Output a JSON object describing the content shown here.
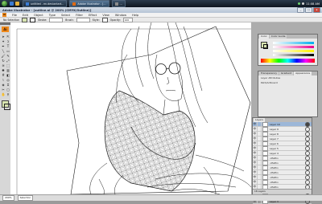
{
  "taskbar": {
    "tasks": [
      {
        "label": "untitled - en.deviantart..."
      },
      {
        "label": "Adobe Illustrator - [..."
      },
      {
        "label": "..."
      }
    ],
    "clock": "11:08 AM"
  },
  "window": {
    "title": "Adobe Illustrator - [outline.ai @ 200% (CMYK/Outline)]",
    "buttons": [
      "_",
      "□",
      "x"
    ]
  },
  "menubar": {
    "logo": "Ai",
    "items": [
      "File",
      "Edit",
      "Object",
      "Type",
      "Select",
      "Filter",
      "Effect",
      "View",
      "Window",
      "Help"
    ]
  },
  "controlbar": {
    "selection_label": "No Selection",
    "stroke_label": "Stroke:",
    "brush_label": "Brush:",
    "style_label": "Style:",
    "opacity_label": "Opacity:",
    "opacity_value": "100"
  },
  "colors": {
    "accent": "#f08a1c",
    "fill_swatch": "#d8e4b0",
    "layer_selected": "#9cb7d8"
  },
  "color_panel": {
    "tabs": [
      "Color",
      "Color Guide"
    ]
  },
  "appearance_panel": {
    "tabs": [
      "Transparency",
      "Gradient",
      "Appearance"
    ],
    "rows": [
      "Layer Attributes",
      "Path/Artboard"
    ]
  },
  "layers_panel": {
    "tabs": [
      "Layers"
    ],
    "rows": [
      "Layer 10",
      "Layer 9",
      "Layer 8",
      "Layer 7",
      "Layer 6",
      "Layer 5",
      "Layer 4",
      "<Path>",
      "<Path>",
      "<Path>",
      "<Path>",
      "<Path>",
      "<Path>",
      "<Path>",
      "<Path>",
      "<Path>",
      "Layer 3"
    ],
    "selected_index": 0,
    "footer": "16 Layers"
  },
  "statusbar": {
    "zoom": "200%",
    "tool": "Selection"
  }
}
